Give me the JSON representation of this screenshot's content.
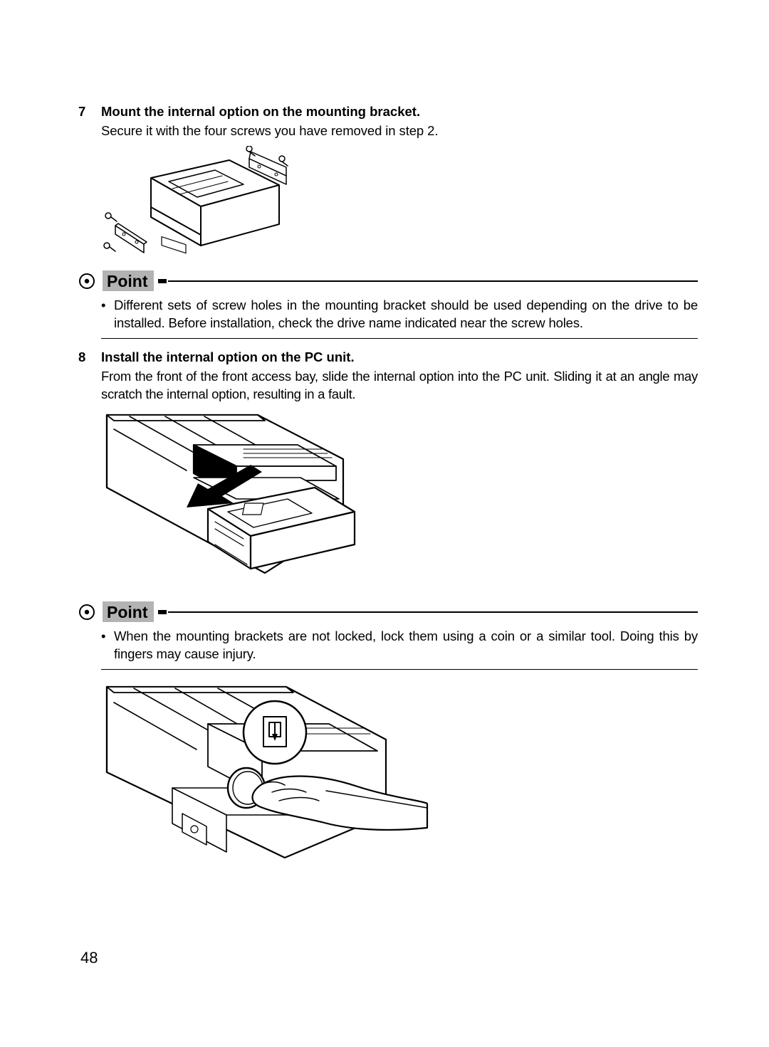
{
  "steps": [
    {
      "num": "7",
      "title": "Mount the internal option on the mounting bracket.",
      "body": "Secure it with the four screws you have removed in step 2."
    },
    {
      "num": "8",
      "title": "Install the internal option on the PC unit.",
      "body": "From the front of the front access bay, slide the internal option into the PC unit. Sliding it at an angle may scratch the internal option, resulting in a fault."
    }
  ],
  "points": [
    {
      "label": "Point",
      "bullet": "•",
      "text": "Different sets of screw holes in the mounting bracket should be used depending on the drive to be installed. Before installation, check the drive name indicated near the screw holes."
    },
    {
      "label": "Point",
      "bullet": "•",
      "text": "When the mounting brackets are not locked, lock them using a coin or a similar tool. Doing this by fingers may cause injury."
    }
  ],
  "page_number": "48"
}
